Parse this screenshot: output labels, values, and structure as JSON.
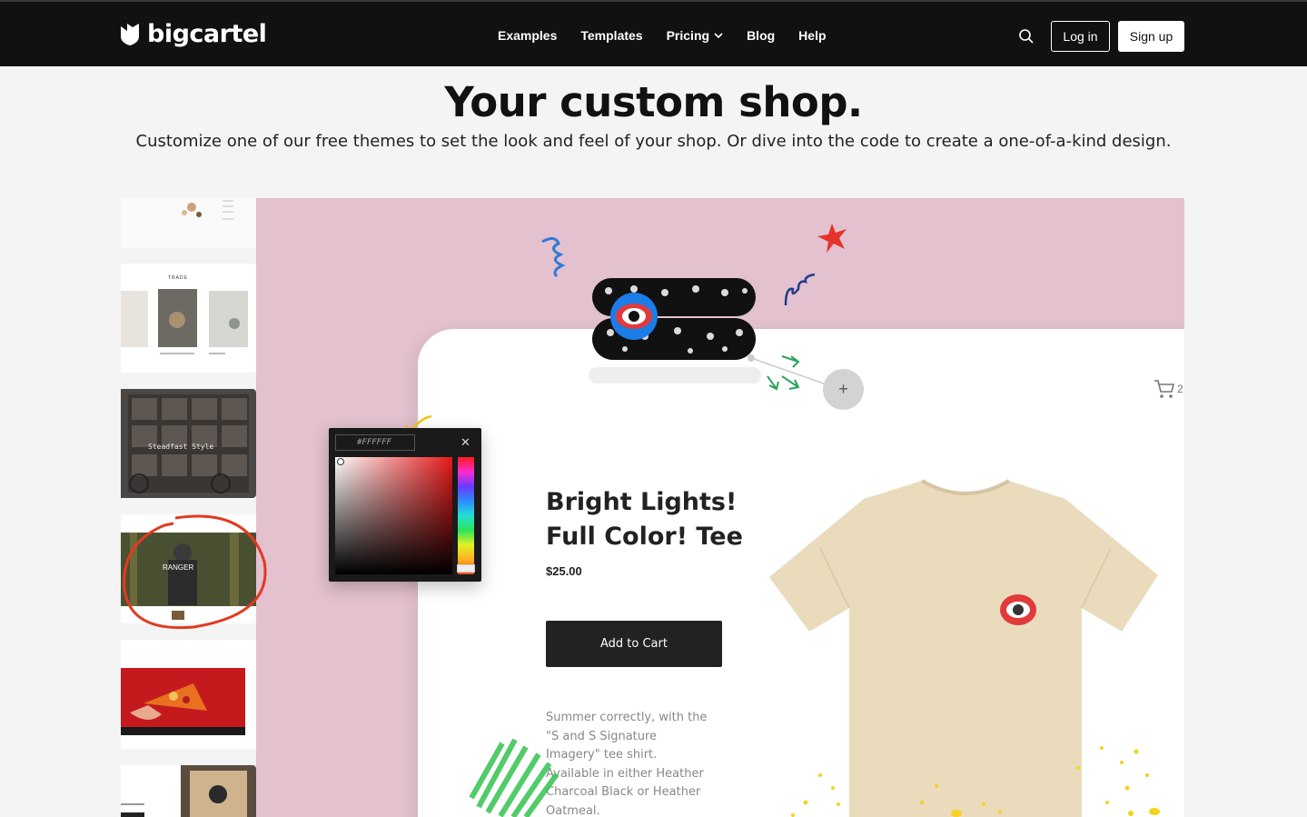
{
  "nav": {
    "logo_text": "bigcartel",
    "links": [
      {
        "label": "Examples"
      },
      {
        "label": "Templates"
      },
      {
        "label": "Pricing",
        "has_dropdown": true
      },
      {
        "label": "Blog"
      },
      {
        "label": "Help"
      }
    ],
    "login_label": "Log in",
    "signup_label": "Sign up"
  },
  "hero": {
    "title": "Your custom shop.",
    "subtitle": "Customize one of our free themes to set the look and feel of your shop. Or dive into the code to create a one-of-a-kind design."
  },
  "themes": {
    "thumbnails": [
      {
        "label": ""
      },
      {
        "label": "TRADE"
      },
      {
        "label": "Steadfast Style"
      },
      {
        "label": "RANGER"
      },
      {
        "label": ""
      },
      {
        "label": ""
      }
    ]
  },
  "product": {
    "title": "Bright Lights! Full Color! Tee",
    "price": "$25.00",
    "add_to_cart": "Add to Cart",
    "description": "Summer correctly, with the \"S and S Signature Imagery\" tee shirt. Available in either Heather Charcoal Black or Heather Oatmeal.",
    "cart_count": "2"
  },
  "color_picker": {
    "hex_value": "#FFFFFF"
  },
  "colors": {
    "nav_bg": "#111111",
    "showcase_bg": "#e3c1cf",
    "button_dark": "#222222",
    "tee": "#eadbbc"
  }
}
